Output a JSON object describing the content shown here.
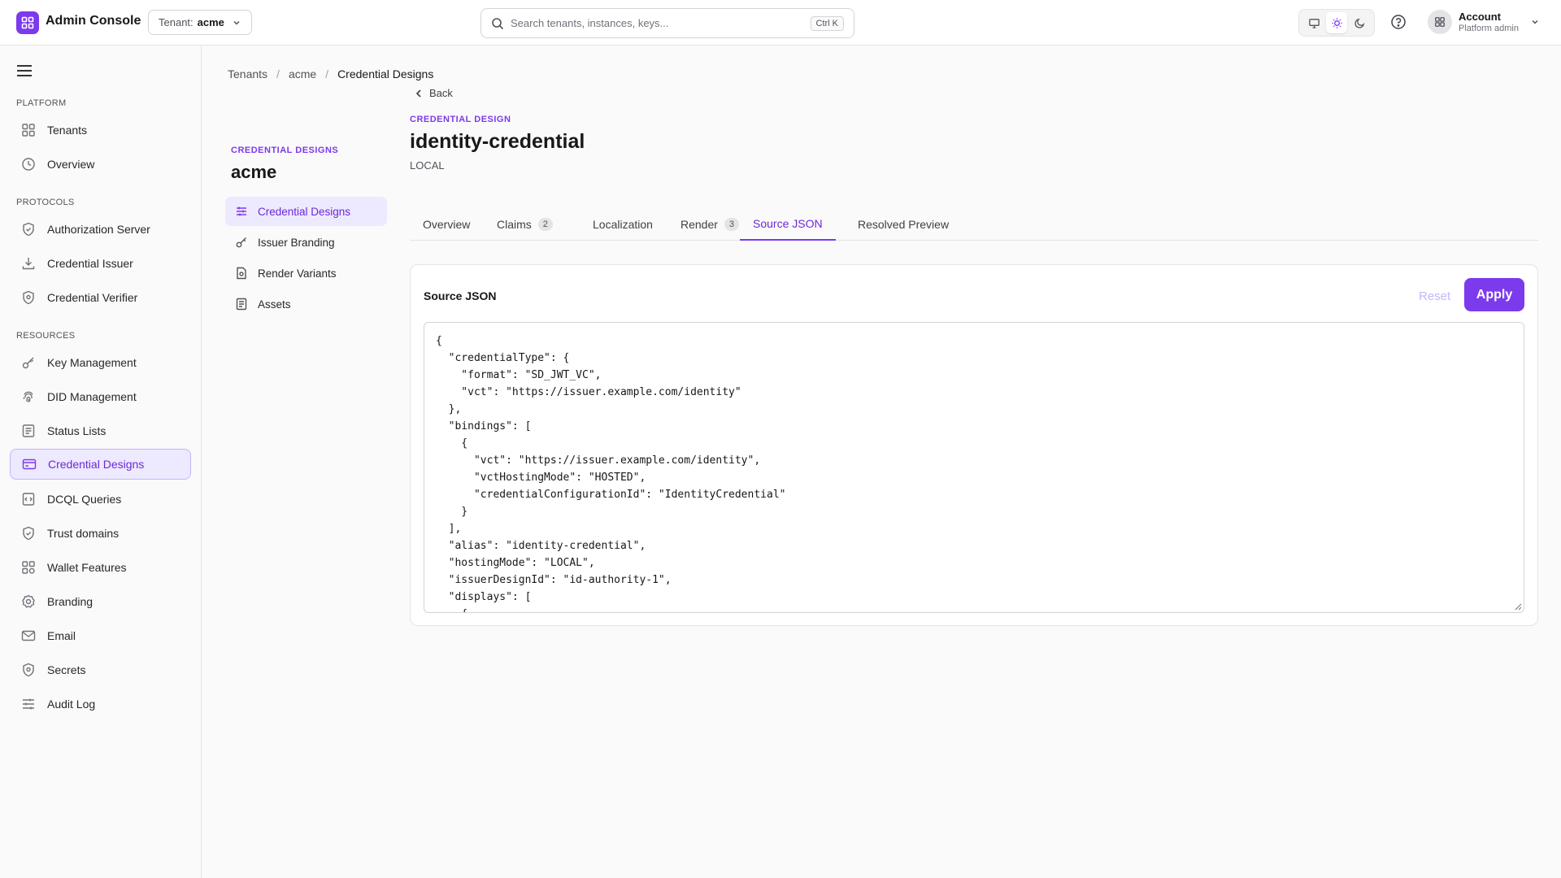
{
  "topbar": {
    "app_title": "Admin Console",
    "tenant_label": "Tenant:",
    "tenant_value": "acme",
    "search_placeholder": "Search tenants, instances, keys...",
    "search_shortcut": "Ctrl K",
    "account_name": "Account",
    "account_role": "Platform admin",
    "active_theme": "light"
  },
  "sidebar": {
    "sections": [
      {
        "label": "PLATFORM",
        "items": [
          {
            "label": "Tenants",
            "icon": "grid-icon"
          },
          {
            "label": "Overview",
            "icon": "clock-icon"
          }
        ]
      },
      {
        "label": "PROTOCOLS",
        "items": [
          {
            "label": "Authorization Server",
            "icon": "shield-check-icon"
          },
          {
            "label": "Credential Issuer",
            "icon": "download-icon"
          },
          {
            "label": "Credential Verifier",
            "icon": "shield-icon"
          }
        ]
      },
      {
        "label": "RESOURCES",
        "items": [
          {
            "label": "Key Management",
            "icon": "key-icon"
          },
          {
            "label": "DID Management",
            "icon": "fingerprint-icon"
          },
          {
            "label": "Status Lists",
            "icon": "list-icon"
          },
          {
            "label": "Credential Designs",
            "icon": "card-icon",
            "active": true
          },
          {
            "label": "DCQL Queries",
            "icon": "code-icon"
          },
          {
            "label": "Trust domains",
            "icon": "shield-icon"
          },
          {
            "label": "Wallet Features",
            "icon": "grid-icon"
          },
          {
            "label": "Branding",
            "icon": "badge-icon"
          },
          {
            "label": "Email",
            "icon": "mail-icon"
          },
          {
            "label": "Secrets",
            "icon": "shield-icon"
          },
          {
            "label": "Audit Log",
            "icon": "sliders-icon"
          }
        ]
      }
    ]
  },
  "breadcrumb": [
    "Tenants",
    "acme",
    "Credential Designs"
  ],
  "subnav": {
    "eyebrow": "CREDENTIAL DESIGNS",
    "title": "acme",
    "items": [
      {
        "label": "Credential Designs",
        "icon": "sliders-icon",
        "active": true
      },
      {
        "label": "Issuer Branding",
        "icon": "key-icon"
      },
      {
        "label": "Render Variants",
        "icon": "file-icon"
      },
      {
        "label": "Assets",
        "icon": "list-icon"
      }
    ]
  },
  "detail": {
    "back_label": "Back",
    "eyebrow": "CREDENTIAL DESIGN",
    "title": "identity-credential",
    "subtitle": "LOCAL"
  },
  "tabs": [
    {
      "label": "Overview",
      "count": null
    },
    {
      "label": "Claims",
      "count": "2"
    },
    {
      "label": "Localization",
      "count": null
    },
    {
      "label": "Render",
      "count": "3"
    },
    {
      "label": "Source JSON",
      "count": null,
      "active": true
    },
    {
      "label": "Resolved Preview",
      "count": null
    }
  ],
  "editor": {
    "title": "Source JSON",
    "reset_label": "Reset",
    "apply_label": "Apply",
    "content": "{\n  \"credentialType\": {\n    \"format\": \"SD_JWT_VC\",\n    \"vct\": \"https://issuer.example.com/identity\"\n  },\n  \"bindings\": [\n    {\n      \"vct\": \"https://issuer.example.com/identity\",\n      \"vctHostingMode\": \"HOSTED\",\n      \"credentialConfigurationId\": \"IdentityCredential\"\n    }\n  ],\n  \"alias\": \"identity-credential\",\n  \"hostingMode\": \"LOCAL\",\n  \"issuerDesignId\": \"id-authority-1\",\n  \"displays\": [\n    {"
  },
  "colors": {
    "accent": "#7c3aed",
    "accent_light": "#ede9fe"
  }
}
